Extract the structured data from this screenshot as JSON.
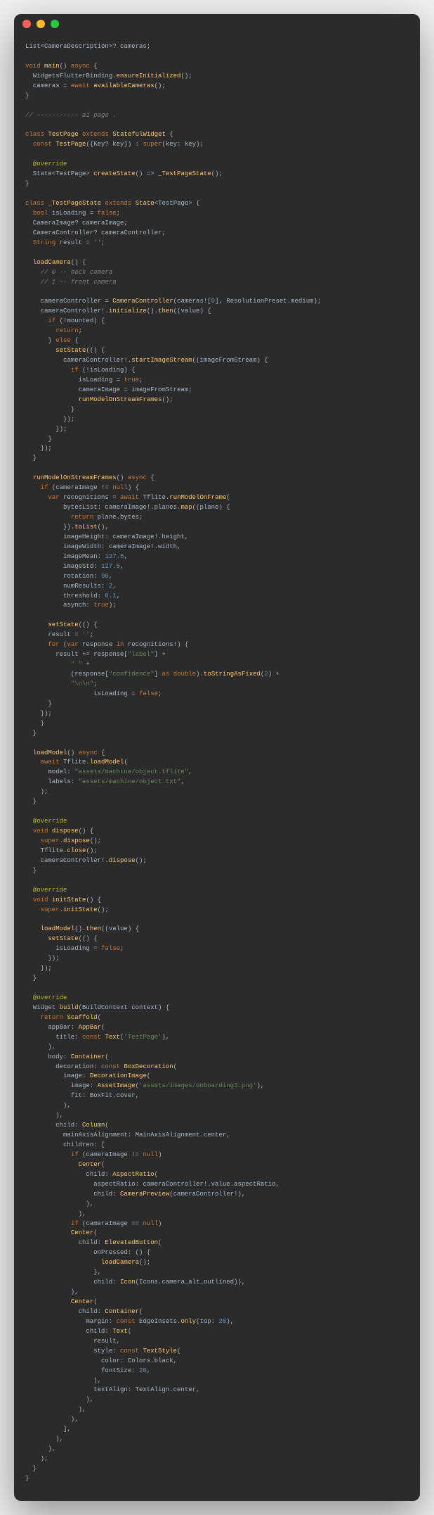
{
  "window": {
    "dots": [
      "red",
      "yellow",
      "green"
    ]
  },
  "code": {
    "l1": "List<CameraDescription>? cameras;",
    "l2": "void main() async {",
    "l3": "  WidgetsFlutterBinding.ensureInitialized();",
    "l4": "  cameras = await availableCameras();",
    "l5": "}",
    "l6": "// ----------- ai page .",
    "l7": "class TestPage extends StatefulWidget {",
    "l8": "  const TestPage({Key? key}) : super(key: key);",
    "l9": "  @override",
    "l10": "  State<TestPage> createState() => _TestPageState();",
    "l11": "}",
    "l12": "class _TestPageState extends State<TestPage> {",
    "l13": "  bool isLoading = false;",
    "l14": "  CameraImage? cameraImage;",
    "l15": "  CameraController? cameraController;",
    "l16": "  String result = '';",
    "l17": "  loadCamera() {",
    "l18": "    // 0 -- back camera",
    "l19": "    // 1 -- front camera",
    "l20": "    cameraController = CameraController(cameras![0], ResolutionPreset.medium);",
    "l21": "    cameraController!.initialize().then((value) {",
    "l22": "      if (!mounted) {",
    "l23": "        return;",
    "l24": "      } else {",
    "l25": "        setState(() {",
    "l26": "          cameraController!.startImageStream((imageFromStream) {",
    "l27": "            if (!isLoading) {",
    "l28": "              isLoading = true;",
    "l29": "              cameraImage = imageFromStream;",
    "l30": "              runModelOnStreamFrames();",
    "l31": "            }",
    "l32": "          });",
    "l33": "        });",
    "l34": "      }",
    "l35": "    });",
    "l36": "  }",
    "l37": "  runModelOnStreamFrames() async {",
    "l38": "    if (cameraImage != null) {",
    "l39": "      var recognitions = await Tflite.runModelOnFrame(",
    "l40": "          bytesList: cameraImage!.planes.map((plane) {",
    "l41": "            return plane.bytes;",
    "l42": "          }).toList(),",
    "l43": "          imageHeight: cameraImage!.height,",
    "l44": "          imageWidth: cameraImage!.width,",
    "l45": "          imageMean: 127.5,",
    "l46": "          imageStd: 127.5,",
    "l47": "          rotation: 90,",
    "l48": "          numResults: 2,",
    "l49": "          threshold: 0.1,",
    "l50": "          asynch: true);",
    "l51": "      setState(() {",
    "l52": "      result = '';",
    "l53": "      for (var response in recognitions!) {",
    "l54": "        result += response[\"label\"] +",
    "l55": "            \" \" +",
    "l56": "            (response[\"confidence\"] as double).toStringAsFixed(2) +",
    "l57": "            \"\\n\\n\";",
    "l58": "                  isLoading = false;",
    "l59": "      }",
    "l60": "    });",
    "l61": "    }",
    "l62": "  }",
    "l63": "  loadModel() async {",
    "l64": "    await Tflite.loadModel(",
    "l65": "      model: \"assets/machine/object.tflite\",",
    "l66": "      labels: \"assets/machine/object.txt\",",
    "l67": "    );",
    "l68": "  }",
    "l69": "  @override",
    "l70": "  void dispose() {",
    "l71": "    super.dispose();",
    "l72": "    Tflite.close();",
    "l73": "    cameraController!.dispose();",
    "l74": "  }",
    "l75": "  @override",
    "l76": "  void initState() {",
    "l77": "    super.initState();",
    "l78": "    loadModel().then((value) {",
    "l79": "      setState(() {",
    "l80": "        isLoading = false;",
    "l81": "      });",
    "l82": "    });",
    "l83": "  }",
    "l84": "  @override",
    "l85": "  Widget build(BuildContext context) {",
    "l86": "    return Scaffold(",
    "l87": "      appBar: AppBar(",
    "l88": "        title: const Text('TestPage'),",
    "l89": "      ),",
    "l90": "      body: Container(",
    "l91": "        decoration: const BoxDecoration(",
    "l92": "          image: DecorationImage(",
    "l93": "            image: AssetImage('assets/images/onboarding3.png'),",
    "l94": "            fit: BoxFit.cover,",
    "l95": "          ),",
    "l96": "        ),",
    "l97": "        child: Column(",
    "l98": "          mainAxisAlignment: MainAxisAlignment.center,",
    "l99": "          children: [",
    "l100": "            if (cameraImage != null)",
    "l101": "              Center(",
    "l102": "                child: AspectRatio(",
    "l103": "                  aspectRatio: cameraController!.value.aspectRatio,",
    "l104": "                  child: CameraPreview(cameraController!),",
    "l105": "                ),",
    "l106": "              ),",
    "l107": "            if (cameraImage == null)",
    "l108": "            Center(",
    "l109": "              child: ElevatedButton(",
    "l110": "                  onPressed: () {",
    "l111": "                    loadCamera();",
    "l112": "                  },",
    "l113": "                  child: Icon(Icons.camera_alt_outlined)),",
    "l114": "            ),",
    "l115": "            Center(",
    "l116": "              child: Container(",
    "l117": "                margin: const EdgeInsets.only(top: 20),",
    "l118": "                child: Text(",
    "l119": "                  result,",
    "l120": "                  style: const TextStyle(",
    "l121": "                    color: Colors.black,",
    "l122": "                    fontSize: 20,",
    "l123": "                  ),",
    "l124": "                  textAlign: TextAlign.center,",
    "l125": "                ),",
    "l126": "              ),",
    "l127": "            ),",
    "l128": "          ],",
    "l129": "        ),",
    "l130": "      ),",
    "l131": "    );",
    "l132": "  }",
    "l133": "}"
  }
}
